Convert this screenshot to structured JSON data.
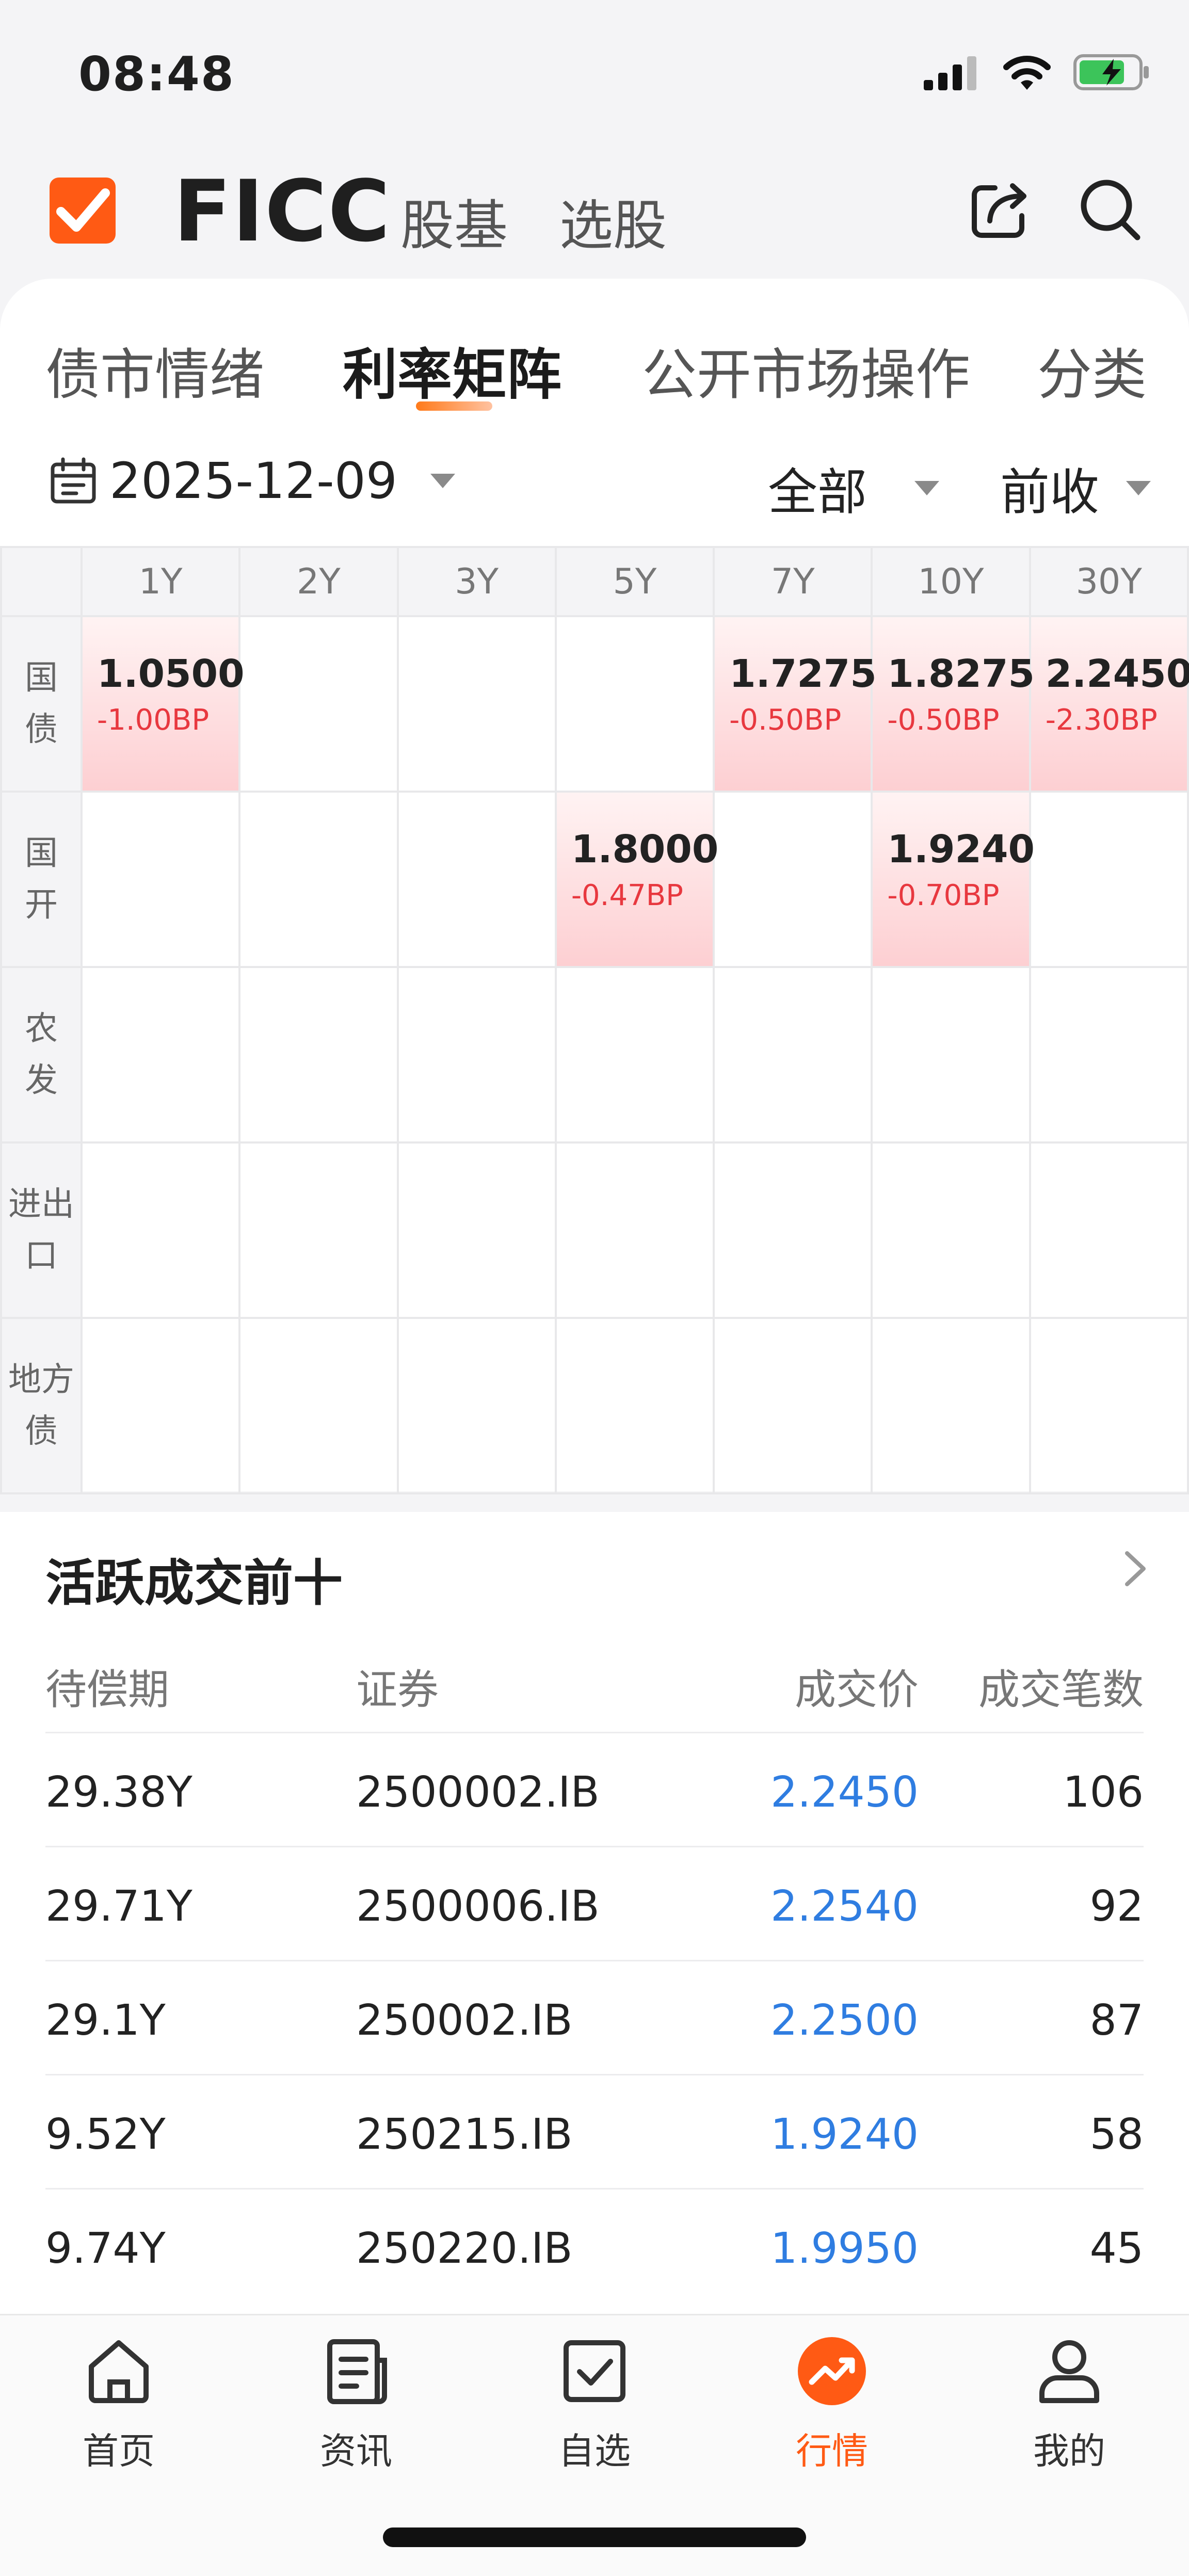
{
  "status_bar": {
    "time": "08:48"
  },
  "header": {
    "title": "FICC",
    "tabs": [
      "股基",
      "选股"
    ]
  },
  "tabs": [
    {
      "label": "债市情绪"
    },
    {
      "label": "利率矩阵",
      "active": true
    },
    {
      "label": "公开市场操作"
    },
    {
      "label": "分类"
    }
  ],
  "filters": {
    "date": "2025-12-09",
    "scope": "全部",
    "price_type": "前收"
  },
  "matrix": {
    "columns": [
      "1Y",
      "2Y",
      "3Y",
      "5Y",
      "7Y",
      "10Y",
      "30Y"
    ],
    "rows": [
      {
        "label": "国债",
        "cells": [
          {
            "value": "1.0500",
            "change": "-1.00BP"
          },
          {},
          {},
          {},
          {
            "value": "1.7275",
            "change": "-0.50BP"
          },
          {
            "value": "1.8275",
            "change": "-0.50BP"
          },
          {
            "value": "2.2450",
            "change": "-2.30BP"
          }
        ]
      },
      {
        "label": "国开",
        "cells": [
          {},
          {},
          {},
          {
            "value": "1.8000",
            "change": "-0.47BP"
          },
          {},
          {
            "value": "1.9240",
            "change": "-0.70BP"
          },
          {}
        ]
      },
      {
        "label": "农发",
        "cells": [
          {},
          {},
          {},
          {},
          {},
          {},
          {}
        ]
      },
      {
        "label": "进出口",
        "cells": [
          {},
          {},
          {},
          {},
          {},
          {},
          {}
        ]
      },
      {
        "label": "地方债",
        "cells": [
          {},
          {},
          {},
          {},
          {},
          {},
          {}
        ]
      }
    ]
  },
  "active_trades": {
    "title": "活跃成交前十",
    "headers": [
      "待偿期",
      "证券",
      "成交价",
      "成交笔数"
    ],
    "rows": [
      {
        "maturity": "29.38Y",
        "security": "2500002.IB",
        "price": "2.2450",
        "count": "106"
      },
      {
        "maturity": "29.71Y",
        "security": "2500006.IB",
        "price": "2.2540",
        "count": "92"
      },
      {
        "maturity": "29.1Y",
        "security": "250002.IB",
        "price": "2.2500",
        "count": "87"
      },
      {
        "maturity": "9.52Y",
        "security": "250215.IB",
        "price": "1.9240",
        "count": "58"
      },
      {
        "maturity": "9.74Y",
        "security": "250220.IB",
        "price": "1.9950",
        "count": "45"
      }
    ]
  },
  "bottom_nav": [
    {
      "label": "首页",
      "icon": "home-icon"
    },
    {
      "label": "资讯",
      "icon": "news-icon"
    },
    {
      "label": "自选",
      "icon": "watchlist-icon"
    },
    {
      "label": "行情",
      "icon": "market-icon",
      "active": true
    },
    {
      "label": "我的",
      "icon": "profile-icon"
    }
  ],
  "colors": {
    "accent": "#ff5a14",
    "up_red": "#e8383f",
    "price_blue": "#2f7de1"
  }
}
